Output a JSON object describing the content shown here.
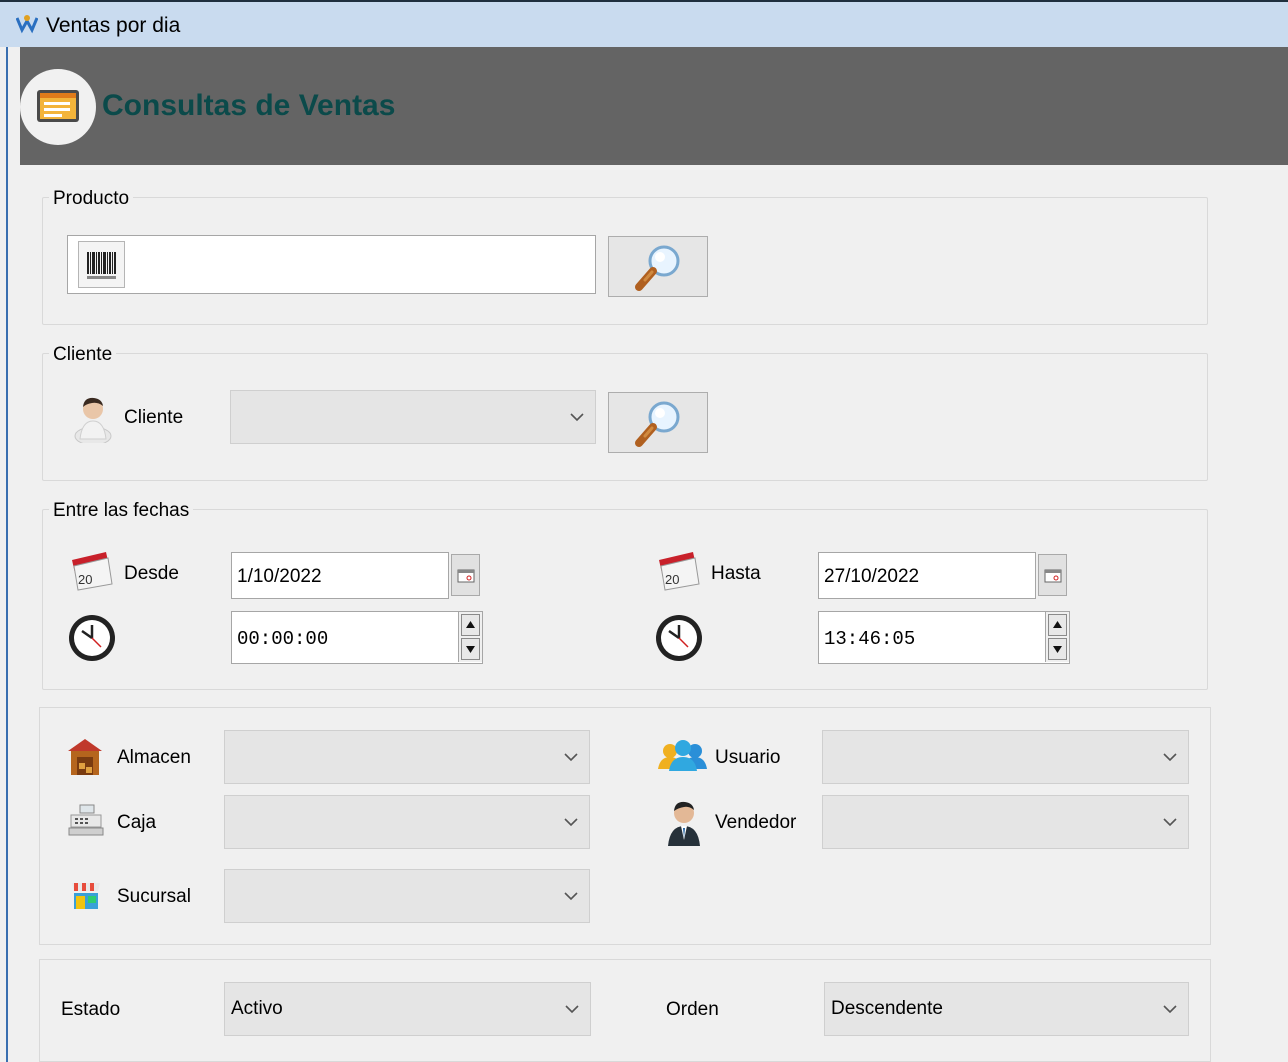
{
  "window": {
    "title": "Ventas por dia"
  },
  "header": {
    "title": "Consultas de Ventas",
    "icon": "report-window-icon"
  },
  "producto": {
    "legend": "Producto",
    "value": "",
    "search_icon": "magnifier-icon"
  },
  "cliente": {
    "legend": "Cliente",
    "label": "Cliente",
    "value": ""
  },
  "fechas": {
    "legend": "Entre las fechas",
    "desde_label": "Desde",
    "desde_date": "1/10/2022",
    "desde_time": "00:00:00",
    "hasta_label": "Hasta",
    "hasta_date": "27/10/2022",
    "hasta_time": "13:46:05"
  },
  "filtros": {
    "almacen_label": "Almacen",
    "caja_label": "Caja",
    "sucursal_label": "Sucursal",
    "usuario_label": "Usuario",
    "vendedor_label": "Vendedor"
  },
  "opciones": {
    "estado_label": "Estado",
    "estado_value": "Activo",
    "orden_label": "Orden",
    "orden_value": "Descendente"
  },
  "colors": {
    "header_bg": "#646464",
    "header_text": "#0b4a4a",
    "titlebar_bg": "#c9dbef"
  }
}
